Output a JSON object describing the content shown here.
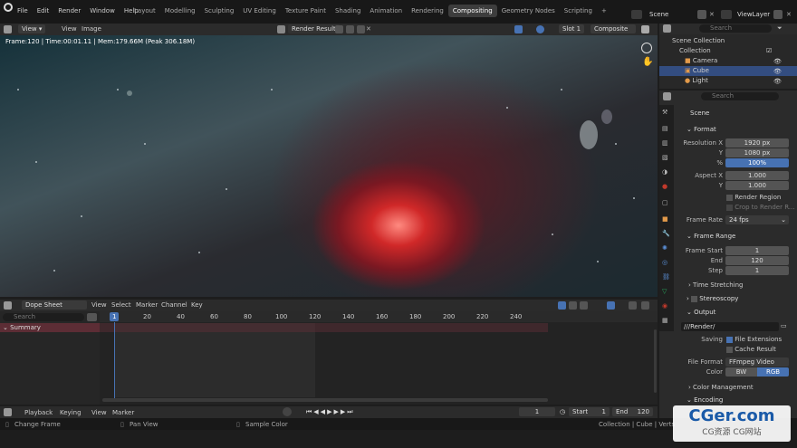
{
  "topbar": {
    "menus": [
      "File",
      "Edit",
      "Render",
      "Window",
      "Help"
    ],
    "workspaces": [
      "Layout",
      "Modelling",
      "Sculpting",
      "UV Editing",
      "Texture Paint",
      "Shading",
      "Animation",
      "Rendering",
      "Compositing",
      "Geometry Nodes",
      "Scripting"
    ],
    "active_workspace": "Compositing",
    "scene": "Scene",
    "viewlayer": "ViewLayer"
  },
  "image_editor": {
    "menus": [
      "View",
      "View",
      "Image"
    ],
    "image_name": "Render Result",
    "slot": "Slot 1",
    "layer": "Composite",
    "stats": "Frame:120 | Time:00:01.11 | Mem:179.66M (Peak 306.18M)"
  },
  "outliner": {
    "search_placeholder": "Search",
    "scene_collection": "Scene Collection",
    "items": [
      "Collection",
      "Camera",
      "Cube",
      "Light"
    ]
  },
  "properties": {
    "search_placeholder": "Search",
    "scene": "Scene",
    "format": {
      "title": "Format",
      "res_x_label": "Resolution X",
      "res_x": "1920 px",
      "res_y_label": "Y",
      "res_y": "1080 px",
      "percent_label": "%",
      "percent": "100%",
      "aspect_x_label": "Aspect X",
      "aspect_x": "1.000",
      "aspect_y_label": "Y",
      "aspect_y": "1.000",
      "render_region": "Render Region",
      "crop": "Crop to Render R...",
      "frame_rate_label": "Frame Rate",
      "frame_rate": "24 fps"
    },
    "frame_range": {
      "title": "Frame Range",
      "start_label": "Frame Start",
      "start": "1",
      "end_label": "End",
      "end": "120",
      "step_label": "Step",
      "step": "1",
      "time_stretching": "Time Stretching"
    },
    "stereoscopy": "Stereoscopy",
    "output": {
      "title": "Output",
      "path": "///Render/",
      "saving_label": "Saving",
      "file_ext": "File Extensions",
      "cache": "Cache Result",
      "format_label": "File Format",
      "format": "FFmpeg Video",
      "color_label": "Color",
      "bw": "BW",
      "rgb": "RGB",
      "color_mgmt": "Color Management",
      "encoding": "Encoding"
    }
  },
  "dopesheet": {
    "mode": "Dope Sheet",
    "menus": [
      "View",
      "Select",
      "Marker",
      "Channel",
      "Key"
    ],
    "search_placeholder": "Search",
    "summary": "Summary",
    "current_frame": "1",
    "ticks": [
      "20",
      "40",
      "60",
      "80",
      "100",
      "120",
      "140",
      "160",
      "180",
      "200",
      "220",
      "240"
    ]
  },
  "timeline": {
    "menus": [
      "Playback",
      "Keying",
      "View",
      "Marker"
    ],
    "frame": "1",
    "start_label": "Start",
    "start": "1",
    "end_label": "End",
    "end": "120"
  },
  "statusbar": {
    "change_frame": "Change Frame",
    "pan_view": "Pan View",
    "sample_color": "Sample Color",
    "info": "Collection | Cube | Verts"
  },
  "watermark": {
    "title": "CGer.com",
    "subtitle": "CG资源 CG网站"
  },
  "colors": {
    "accent": "#4772b3",
    "active_tab": "#3d3d3d",
    "summary": "#5c2d35"
  }
}
